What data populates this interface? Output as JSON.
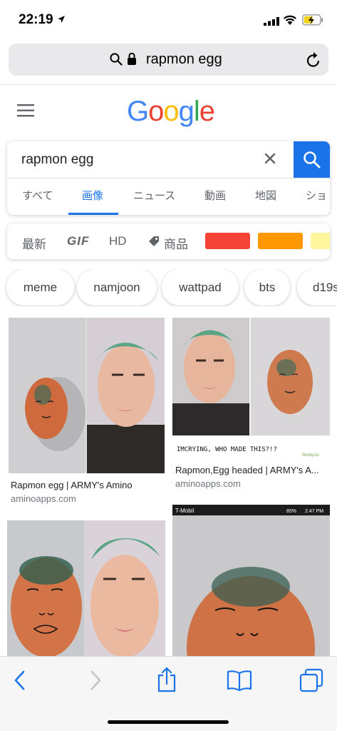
{
  "status": {
    "time": "22:19",
    "icons": [
      "location-arrow-icon",
      "signal-icon",
      "wifi-icon",
      "battery-charging-icon"
    ]
  },
  "urlbar": {
    "query": "rapmon egg",
    "icons": [
      "search-icon",
      "lock-icon",
      "reload-icon"
    ]
  },
  "logo": {
    "letters": [
      "G",
      "o",
      "o",
      "g",
      "l",
      "e"
    ],
    "colors": [
      "#4285F4",
      "#EA4335",
      "#FBBC05",
      "#4285F4",
      "#34A853",
      "#EA4335"
    ]
  },
  "search": {
    "query": "rapmon egg",
    "tabs": [
      "すべて",
      "画像",
      "ニュース",
      "動画",
      "地図",
      "ショ"
    ],
    "active_tab": "画像"
  },
  "filters": {
    "items": [
      "最新",
      "GIF",
      "HD",
      "商品"
    ],
    "swatches": [
      "#f44336",
      "#ff9800",
      "#fff59d"
    ]
  },
  "chips": [
    "meme",
    "namjoon",
    "wattpad",
    "bts",
    "d19s"
  ],
  "results": [
    {
      "title": "Rapmon egg | ARMY's Amino",
      "source": "aminoapps.com"
    },
    {
      "title": "Rapmon,Egg headed | ARMY's A...",
      "source": "aminoapps.com",
      "caption": "IMCRYING, WHO MADE THIS?!?",
      "watermark": "ifunny.co"
    },
    {
      "title": "",
      "source": ""
    },
    {
      "title": "",
      "source": "",
      "status_text": "T-Mobil",
      "status_battery": "85%",
      "status_time": "2:47 PM"
    }
  ],
  "toolbar": {
    "icons": [
      "back-icon",
      "forward-icon",
      "share-icon",
      "bookmarks-icon",
      "tabs-icon"
    ]
  },
  "accent": "#1a73e8"
}
